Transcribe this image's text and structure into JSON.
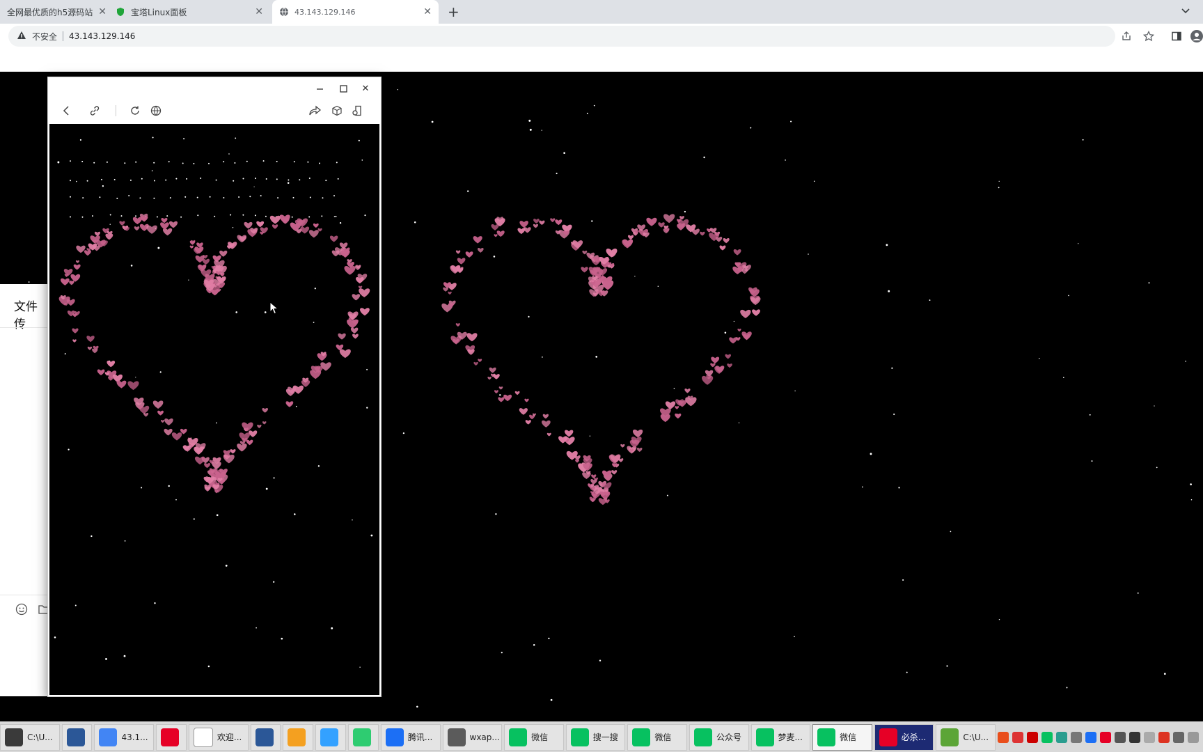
{
  "browser": {
    "tabs": [
      {
        "title": "全网最优质的h5源码站",
        "active": false
      },
      {
        "title": "宝塔Linux面板",
        "active": false
      },
      {
        "title": "43.143.129.146",
        "active": true
      }
    ],
    "new_tab": "+",
    "security_label": "不安全",
    "url": "43.143.129.146"
  },
  "background_app": {
    "title_partial": "文件传"
  },
  "popup": {
    "window_buttons": [
      "minimize",
      "maximize",
      "close"
    ]
  },
  "taskbar": {
    "items": [
      {
        "label": "C:\\U...",
        "icon": "cmd-icon",
        "color": "#3a3a3a"
      },
      {
        "label": "",
        "icon": "doc-icon",
        "color": "#2b5797"
      },
      {
        "label": "43.1...",
        "icon": "chrome-icon",
        "color": "#4285f4"
      },
      {
        "label": "",
        "icon": "netease-music-icon",
        "color": "#e60026"
      },
      {
        "label": "欢迎...",
        "icon": "file-icon",
        "color": "#ffffff"
      },
      {
        "label": "",
        "icon": "doc-icon",
        "color": "#2b5797"
      },
      {
        "label": "",
        "icon": "app-tile-icon",
        "color": "#f4a020"
      },
      {
        "label": "",
        "icon": "app-tile-icon",
        "color": "#33a1ff"
      },
      {
        "label": "",
        "icon": "app-tile-icon",
        "color": "#2ecc71"
      },
      {
        "label": "腾讯...",
        "icon": "tencent-meeting-icon",
        "color": "#1c6ff5"
      },
      {
        "label": "wxap...",
        "icon": "wechat-devtools-icon",
        "color": "#5b5b5b"
      },
      {
        "label": "微信",
        "icon": "wechat-icon",
        "color": "#07c160"
      },
      {
        "label": "搜一搜",
        "icon": "wechat-icon",
        "color": "#07c160"
      },
      {
        "label": "微信",
        "icon": "wechat-icon",
        "color": "#07c160"
      },
      {
        "label": "公众号",
        "icon": "wechat-icon",
        "color": "#07c160"
      },
      {
        "label": "梦麦...",
        "icon": "wechat-icon",
        "color": "#07c160"
      },
      {
        "label": "微信",
        "icon": "wechat-icon",
        "color": "#07c160",
        "active": true
      },
      {
        "label": "必杀...",
        "icon": "netease-music-icon",
        "color": "#e60026",
        "highlight": true
      },
      {
        "label": "C:\\U...",
        "icon": "notepad-icon",
        "color": "#5ca537"
      }
    ]
  },
  "colors": {
    "heart": "#e27fa6",
    "heart_dark": "#c8628c",
    "star": "#ffffff",
    "background": "#000000"
  }
}
